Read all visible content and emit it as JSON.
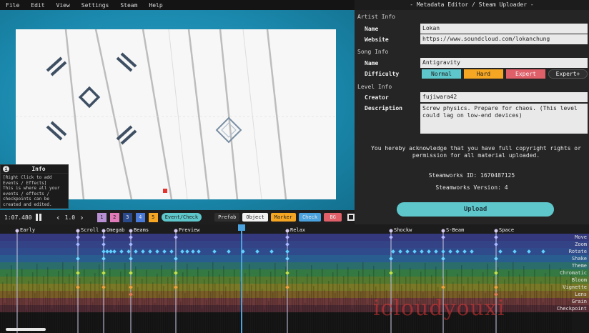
{
  "menu": [
    "File",
    "Edit",
    "View",
    "Settings",
    "Steam",
    "Help"
  ],
  "info": {
    "title": "Info",
    "text": "[Right Click to add Events / Effects]\nThis is where all your events / effects / checkpoints can be created and edited."
  },
  "controls": {
    "time": "1:07.480",
    "speed": "1.0",
    "layers": [
      "1",
      "2",
      "3",
      "4",
      "5"
    ],
    "event_check": "Event/Check",
    "tabs": [
      "Prefab",
      "Object",
      "Marker",
      "Check",
      "BG"
    ]
  },
  "editor": {
    "title": "- Metadata Editor / Steam Uploader -",
    "artist_info": "Artist Info",
    "artist_name_label": "Name",
    "artist_name": "Lokan",
    "website_label": "Website",
    "website": "https://www.soundcloud.com/lokanchung",
    "song_info": "Song Info",
    "song_name_label": "Name",
    "song_name": "Antigravity",
    "difficulty_label": "Difficulty",
    "difficulties": [
      "Normal",
      "Hard",
      "Expert",
      "Expert+"
    ],
    "level_info": "Level Info",
    "creator_label": "Creator",
    "creator": "fujiwara42",
    "description_label": "Description",
    "description": "Screw physics. Prepare for chaos. (This level could lag on low-end devices)",
    "acknowledge": "You hereby acknowledge that you have full copyright rights or permission for all material uploaded.",
    "workshop_id": "Steamworks ID: 1670487125",
    "workshop_version": "Steamworks Version: 4",
    "upload": "Upload"
  },
  "timeline": {
    "checkpoints": [
      "Early",
      "Scroll",
      "Omegab",
      "Beams",
      "Preview",
      "Relax",
      "Shockw",
      "S-Beam",
      "Space"
    ],
    "event_types": [
      "Move",
      "Zoom",
      "Rotate",
      "Shake",
      "Theme",
      "Chromatic",
      "Bloom",
      "Vignette",
      "Lens",
      "Grain",
      "Checkpoint"
    ]
  },
  "colors": {
    "normal": "#5ec7cb",
    "hard": "#f5a623",
    "expert": "#e0606a",
    "expert_plus": "#2f2f2f",
    "accent": "#5ec7cb"
  },
  "watermark": "icloudyouxi"
}
